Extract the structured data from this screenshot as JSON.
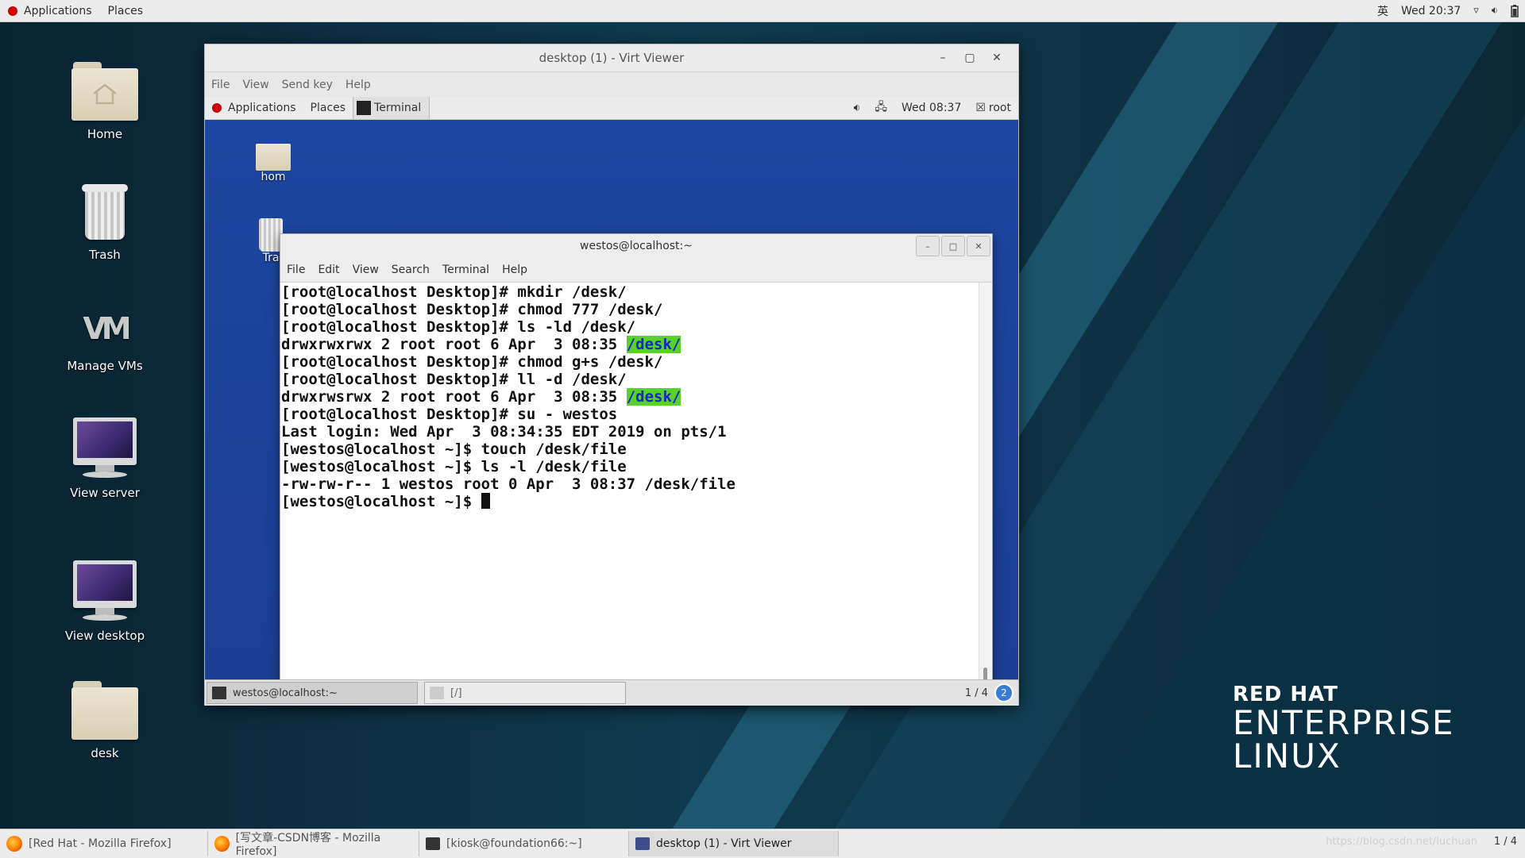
{
  "topbar": {
    "applications": "Applications",
    "places": "Places",
    "input_method": "英",
    "clock": "Wed 20:37"
  },
  "desktop_icons": [
    {
      "label": "Home"
    },
    {
      "label": "Trash"
    },
    {
      "label": "Manage VMs"
    },
    {
      "label": "View server"
    },
    {
      "label": "View desktop"
    },
    {
      "label": "desk"
    }
  ],
  "redhat_logo": {
    "line1": "RED HAT",
    "line2": "ENTERPRISE",
    "line3": "LINUX"
  },
  "virt_viewer": {
    "title": "desktop (1) - Virt Viewer",
    "menu": [
      "File",
      "View",
      "Send key",
      "Help"
    ]
  },
  "guest": {
    "topbar": {
      "applications": "Applications",
      "places": "Places",
      "terminal_tab": "Terminal",
      "clock": "Wed 08:37",
      "user": "root"
    },
    "desktop_icons": [
      {
        "label": "hom"
      },
      {
        "label": "Tra"
      }
    ],
    "terminal": {
      "title": "westos@localhost:~",
      "menu": [
        "File",
        "Edit",
        "View",
        "Search",
        "Terminal",
        "Help"
      ],
      "lines": [
        "[root@localhost Desktop]# mkdir /desk/",
        "[root@localhost Desktop]# chmod 777 /desk/",
        "[root@localhost Desktop]# ls -ld /desk/",
        "drwxrwxrwx 2 root root 6 Apr  3 08:35 ",
        "/desk/",
        "[root@localhost Desktop]# chmod g+s /desk/",
        "[root@localhost Desktop]# ll -d /desk/",
        "drwxrwsrwx 2 root root 6 Apr  3 08:35 ",
        "/desk/",
        "[root@localhost Desktop]# su - westos",
        "Last login: Wed Apr  3 08:34:35 EDT 2019 on pts/1",
        "[westos@localhost ~]$ touch /desk/file",
        "[westos@localhost ~]$ ls -l /desk/file",
        "-rw-rw-r-- 1 westos root 0 Apr  3 08:37 /desk/file",
        "[westos@localhost ~]$ "
      ]
    },
    "taskbar": {
      "task1": "westos@localhost:~",
      "task2": "[/]",
      "pager": "1 / 4",
      "help_badge": "2"
    }
  },
  "host_taskbar": {
    "tasks": [
      {
        "label": "[Red Hat - Mozilla Firefox]"
      },
      {
        "label": "[写文章-CSDN博客 - Mozilla Firefox]"
      },
      {
        "label": "[kiosk@foundation66:~]"
      },
      {
        "label": "desktop (1) - Virt Viewer"
      }
    ],
    "watermark": "https://blog.csdn.net/luchuan",
    "pager": "1 / 4"
  },
  "colors": {
    "terminal_highlight_bg": "#59d12c",
    "terminal_highlight_fg": "#1727c4",
    "guest_desktop": "#1d46a0",
    "redhat_red": "#cc0000"
  }
}
